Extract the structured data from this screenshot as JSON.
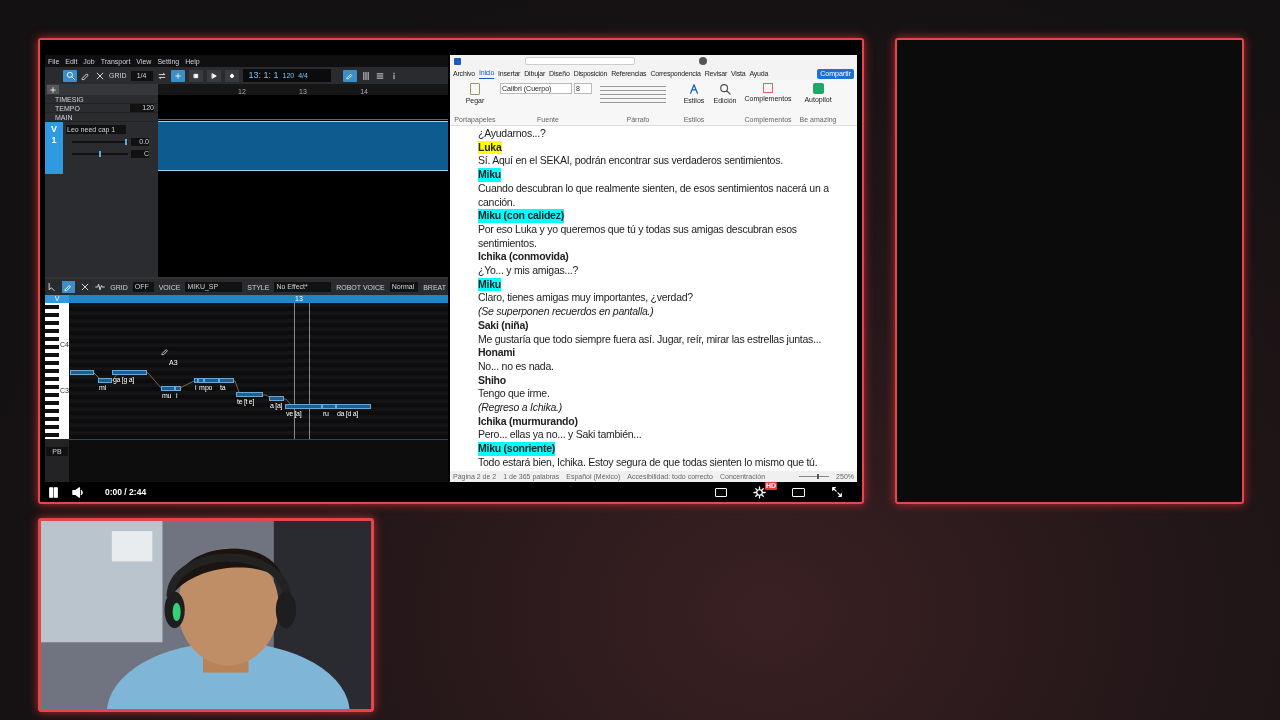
{
  "player": {
    "playing": true,
    "time": "0:00 / 2:44",
    "quality_badge": "HD"
  },
  "editor": {
    "menu": [
      "File",
      "Edit",
      "Job",
      "Transport",
      "View",
      "Setting",
      "Help"
    ],
    "grid_label": "GRID",
    "grid_value": "1/4",
    "position": "13: 1: 1",
    "tempo": "120",
    "signature": "4/4",
    "ruler": [
      "12",
      "13",
      "14"
    ],
    "rows": [
      {
        "label": "TIMESIG"
      },
      {
        "label": "TEMPO",
        "value": "120"
      },
      {
        "label": "MAIN"
      }
    ],
    "track": {
      "letter": "V",
      "number": "1",
      "name": "Leo need cap 1",
      "selected": true,
      "volume": {
        "level": 0.98,
        "reading": "0.0"
      },
      "pan": {
        "level": 0.5,
        "reading": "C"
      }
    },
    "roll_toolbar": [
      {
        "label": "GRID",
        "value": "OFF"
      },
      {
        "label": "VOICE",
        "value": "MIKU_SP"
      },
      {
        "label": "STYLE",
        "value": "No Effect*"
      },
      {
        "label": "ROBOT VOICE",
        "value": "Normal"
      },
      {
        "label": "BREAT"
      }
    ],
    "roll_letter": "V",
    "marker": "13",
    "key_labels": [
      "C4",
      "C3"
    ],
    "hover_note": "A3",
    "lane": "PB",
    "lyrics": [
      "mi",
      "ga [g a]",
      "mu",
      "i",
      "i",
      "m",
      "po",
      "ta",
      "te [t e]",
      "a [a]",
      "ve [a]",
      "ru",
      "da [d a]"
    ]
  },
  "word": {
    "tabs": [
      {
        "label": "Archivo",
        "selected": false
      },
      {
        "label": "Inicio",
        "selected": true
      },
      {
        "label": "Insertar",
        "selected": false
      },
      {
        "label": "Dibujar",
        "selected": false
      },
      {
        "label": "Diseño",
        "selected": false
      },
      {
        "label": "Disposición",
        "selected": false
      },
      {
        "label": "Referencias",
        "selected": false
      },
      {
        "label": "Correspondencia",
        "selected": false
      },
      {
        "label": "Revisar",
        "selected": false
      },
      {
        "label": "Vista",
        "selected": false
      },
      {
        "label": "Ayuda",
        "selected": false
      }
    ],
    "share": "Compartir",
    "font": "Calibri (Cuerpo)",
    "size": "8",
    "ribbon_buttons": [
      "Pegar",
      "Estilos",
      "Edición",
      "Complementos",
      "Autopilot"
    ],
    "groups": [
      "Portapapeles",
      "Fuente",
      "Párrafo",
      "Estilos",
      "Complementos",
      "Be amazing"
    ],
    "lines": [
      {
        "kind": "text",
        "text": "¿Ayudarnos...?"
      },
      {
        "kind": "speaker",
        "text": "Luka",
        "color": "#ffff00"
      },
      {
        "kind": "text",
        "text": "Sí. Aquí en el SEKAI, podrán encontrar sus verdaderos sentimientos."
      },
      {
        "kind": "speaker",
        "text": "Miku",
        "color": "#00ffff"
      },
      {
        "kind": "text",
        "text": "Cuando descubran lo que realmente sienten, de esos sentimientos nacerá un a canción."
      },
      {
        "kind": "speaker",
        "text": "Miku (con calidez)",
        "color": "#00ffff"
      },
      {
        "kind": "text",
        "text": "Por eso Luka y yo queremos que tú y todas sus amigas descubran esos sentimientos."
      },
      {
        "kind": "speaker",
        "text": "Ichika (conmovida)"
      },
      {
        "kind": "text",
        "text": "¿Yo... y mis amigas...?"
      },
      {
        "kind": "speaker",
        "text": "Miku",
        "color": "#00ffff"
      },
      {
        "kind": "text",
        "text": "Claro, tienes amigas muy importantes, ¿verdad?"
      },
      {
        "kind": "stage",
        "text": "(Se superponen recuerdos en pantalla.)"
      },
      {
        "kind": "speaker",
        "text": "Saki (niña)"
      },
      {
        "kind": "text",
        "text": "Me gustaría que todo siempre fuera así. Jugar, reír, mirar las estrellas juntas..."
      },
      {
        "kind": "speaker",
        "text": "Honami"
      },
      {
        "kind": "text",
        "text": "No... no es nada."
      },
      {
        "kind": "speaker",
        "text": "Shiho"
      },
      {
        "kind": "text",
        "text": "Tengo que irme."
      },
      {
        "kind": "stage",
        "text": "(Regreso a Ichika.)"
      },
      {
        "kind": "speaker",
        "text": "Ichika (murmurando)"
      },
      {
        "kind": "text",
        "text": "Pero... ellas ya no... y Saki también..."
      },
      {
        "kind": "speaker",
        "text": "Miku (sonriente)",
        "color": "#00ffff"
      },
      {
        "kind": "text",
        "text": "Todo estará bien, Ichika. Estoy segura de que todas sienten lo mismo que tú."
      }
    ],
    "status": [
      "Página 2 de 2",
      "1 de 365 palabras",
      "Español (México)",
      "Accesibilidad: todo correcto",
      "Concentración"
    ],
    "zoom": "250%",
    "zoom_slider": {
      "level": 0.6
    }
  }
}
